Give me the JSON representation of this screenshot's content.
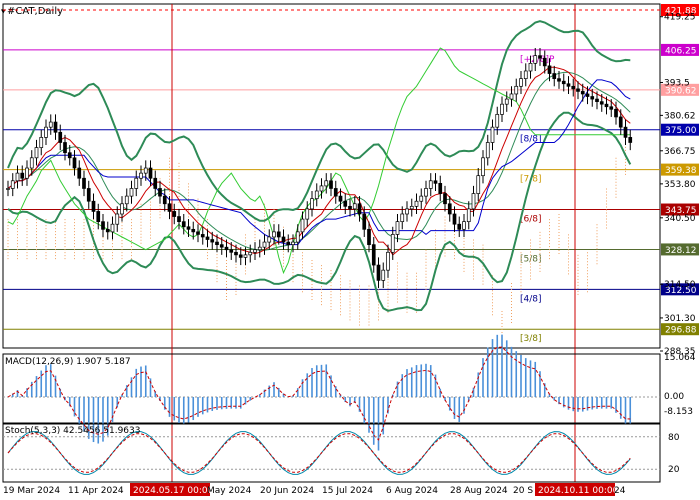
{
  "chart_data": {
    "type": "line",
    "title": "#CAT,Daily",
    "main_price_range": [
      288.35,
      421.88
    ],
    "price_ticks": [
      421.88,
      419.25,
      406.25,
      393.5,
      380.62,
      375.0,
      366.75,
      359.38,
      353.8,
      343.75,
      340.5,
      328.12,
      314.5,
      312.5,
      301.3,
      296.88,
      288.35
    ],
    "price_tick_labels": [
      "421.88",
      "419.25",
      "406.25",
      "393.5",
      "380.62",
      "375.00",
      "366.75",
      "359.38",
      "353.80",
      "343.75",
      "340.50",
      "328.12",
      "314.50",
      "312.50",
      "301.30",
      "296.88",
      "288.35"
    ],
    "highlighted_levels": [
      {
        "value": 421.88,
        "label": "421.88",
        "color": "#ff0000",
        "murray": ""
      },
      {
        "value": 406.25,
        "label": "406.25",
        "color": "#cc00cc",
        "murray": "[+2/8]P"
      },
      {
        "value": 390.62,
        "label": "390.62",
        "color": "#ff9fa0",
        "murray": ""
      },
      {
        "value": 375.0,
        "label": "375.00",
        "color": "#0000aa",
        "murray": "[8/8]"
      },
      {
        "value": 359.38,
        "label": "359.38",
        "color": "#cc9900",
        "murray": "[7/8]"
      },
      {
        "value": 343.75,
        "label": "343.75",
        "color": "#aa0000",
        "murray": "[6/8]"
      },
      {
        "value": 328.12,
        "label": "328.12",
        "color": "#556b2f",
        "murray": "[5/8]"
      },
      {
        "value": 312.5,
        "label": "312.50",
        "color": "#000088",
        "murray": "[4/8]"
      },
      {
        "value": 296.88,
        "label": "296.88",
        "color": "#808000",
        "murray": "[3/8]"
      }
    ],
    "x_labels": [
      "19 Mar 2024",
      "11 Apr 2024",
      "2024.05.17 00:00",
      "May 2024",
      "20 Jun 2024",
      "15 Jul 2024",
      "6 Aug 2024",
      "28 Aug 2024",
      "20 S",
      "2024.10.11 00:00",
      "24"
    ],
    "highlighted_dates": [
      "2024.05.17 00:00",
      "2024.10.11 00:00"
    ],
    "closes": [
      352,
      355,
      358,
      356,
      360,
      364,
      368,
      372,
      376,
      378,
      374,
      370,
      366,
      364,
      360,
      356,
      352,
      347,
      343,
      339,
      336,
      335,
      338,
      342,
      346,
      349,
      352,
      356,
      358,
      360,
      356,
      352,
      349,
      346,
      343,
      341,
      339,
      337,
      336,
      335,
      334,
      333,
      332,
      331,
      330,
      329,
      328,
      327,
      326,
      325,
      326,
      327,
      328,
      329,
      331,
      333,
      335,
      333,
      331,
      330,
      331,
      335,
      340,
      344,
      348,
      351,
      353,
      355,
      352,
      349,
      347,
      345,
      344,
      346,
      342,
      336,
      330,
      322,
      316,
      320,
      327,
      334,
      339,
      342,
      344,
      345,
      347,
      349,
      352,
      355,
      354,
      350,
      346,
      342,
      338,
      336,
      339,
      344,
      350,
      357,
      364,
      370,
      376,
      381,
      385,
      387,
      389,
      392,
      395,
      398,
      401,
      404,
      403,
      400,
      397,
      395,
      394,
      393,
      392,
      391,
      390,
      389,
      388,
      387,
      386,
      385,
      384,
      383,
      380,
      376,
      372,
      370
    ],
    "indicators": {
      "macd": {
        "label": "MACD(12,26,9) 1.907 5.187",
        "ticks": [
          "15.064",
          "0.00",
          "-8.153"
        ],
        "range": [
          -8.153,
          15.064
        ]
      },
      "stoch": {
        "label": "Stoch(5,3,3) 42.5456 51.9633",
        "ticks": [
          "80",
          "20"
        ],
        "range": [
          0,
          100
        ]
      }
    }
  }
}
